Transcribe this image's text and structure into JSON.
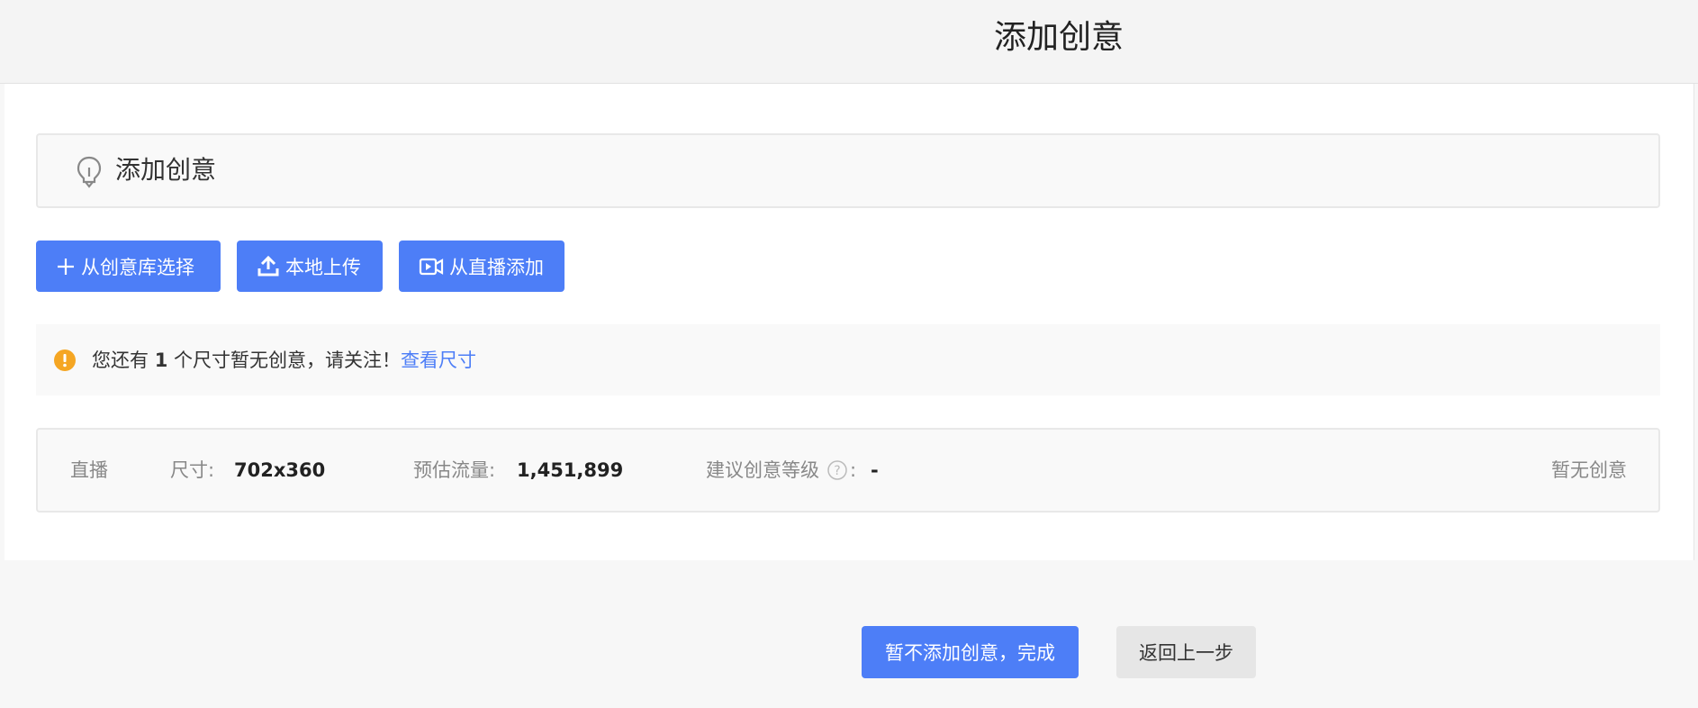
{
  "header": {
    "title": "添加创意"
  },
  "section": {
    "title": "添加创意",
    "icon": "lightbulb-icon"
  },
  "actions": {
    "from_library": "从创意库选择",
    "local_upload": "本地上传",
    "from_live": "从直播添加"
  },
  "notice": {
    "prefix": "您还有 ",
    "count": "1",
    "suffix": " 个尺寸暂无创意，请关注！",
    "link": "查看尺寸",
    "icon_color": "#f5a623"
  },
  "creative_row": {
    "type": "直播",
    "size_label": "尺寸:",
    "size_value": "702x360",
    "traffic_label": "预估流量:",
    "traffic_value": "1,451,899",
    "level_label": "建议创意等级",
    "level_colon": ":",
    "level_value": "-",
    "status": "暂无创意"
  },
  "footer": {
    "finish_label": "暂不添加创意，完成",
    "back_label": "返回上一步"
  },
  "colors": {
    "primary": "#4d7ef7",
    "warning": "#f5a623"
  }
}
